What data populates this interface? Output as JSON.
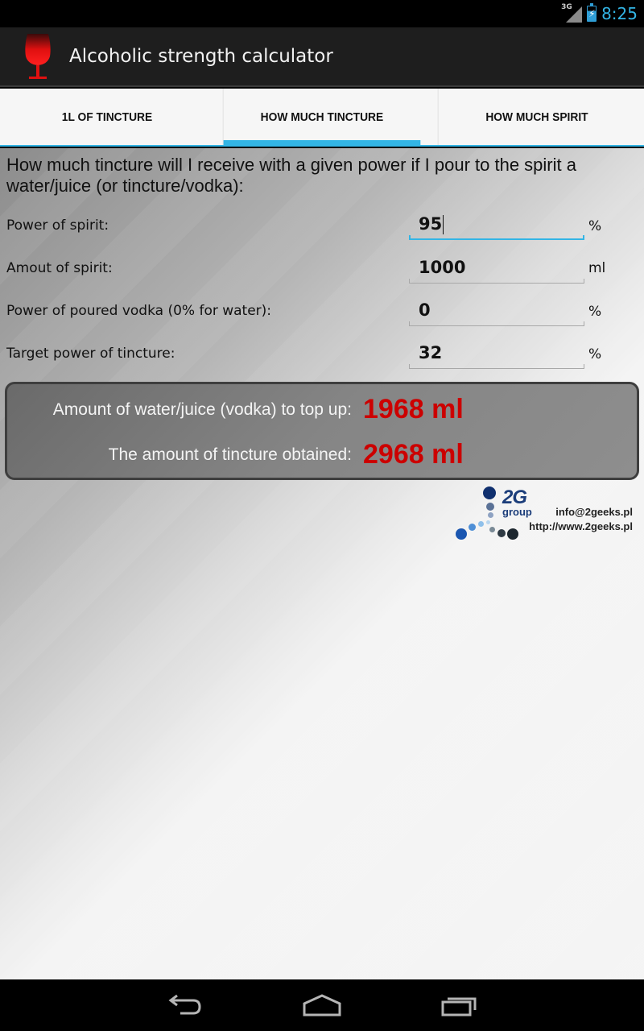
{
  "status_bar": {
    "network": "3G",
    "time": "8:25"
  },
  "action_bar": {
    "title": "Alcoholic strength calculator"
  },
  "tabs": [
    {
      "label": "1L OF TINCTURE",
      "active": false
    },
    {
      "label": "HOW MUCH TINCTURE",
      "active": true
    },
    {
      "label": "HOW MUCH SPIRIT",
      "active": false
    }
  ],
  "main": {
    "intro": "How much tincture will I receive with a given power if I pour to the spirit a water/juice (or tincture/vodka):",
    "fields": [
      {
        "label": "Power of spirit:",
        "value": "95",
        "unit": "%",
        "focused": true
      },
      {
        "label": "Amout of spirit:",
        "value": "1000",
        "unit": "ml",
        "focused": false
      },
      {
        "label": "Power of poured vodka (0% for water):",
        "value": "0",
        "unit": "%",
        "focused": false
      },
      {
        "label": "Target power of tincture:",
        "value": "32",
        "unit": "%",
        "focused": false
      }
    ],
    "results": [
      {
        "label": "Amount of water/juice (vodka) to top up:",
        "value": "1968 ml"
      },
      {
        "label": "The amount of tincture obtained:",
        "value": "2968 ml"
      }
    ]
  },
  "footer_logo": {
    "brand": "2G",
    "subtitle": "group",
    "email": "info@2geeks.pl",
    "url": "http://www.2geeks.pl"
  },
  "nav_bar": {
    "buttons": [
      "back-icon",
      "home-icon",
      "recent-apps-icon"
    ]
  },
  "colors": {
    "accent": "#33b5e5",
    "result_value": "#cc0000",
    "action_bar": "#1e1e1e"
  }
}
